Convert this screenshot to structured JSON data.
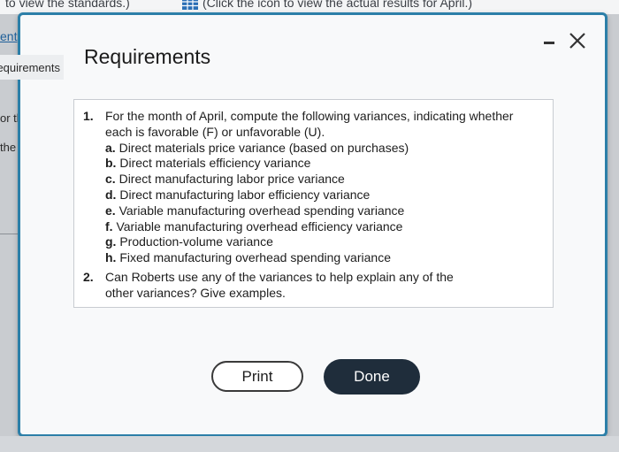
{
  "background": {
    "top_left_text": "to view the standards.)",
    "top_right_text": "(Click the icon to view the actual results for April.)",
    "left_fragments": [
      "or tl",
      "the"
    ],
    "grid_icon": "spreadsheet-grid-icon"
  },
  "dialog": {
    "tab_link": "ent",
    "tab_active": "equirements",
    "title": "Requirements",
    "minimize_icon": "minimize-icon",
    "close_icon": "close-icon",
    "requirements": [
      {
        "number": "1.",
        "lines": [
          "For the month of April, compute the following variances, indicating whether",
          "each is favorable (F) or unfavorable (U)."
        ],
        "subitems": [
          {
            "letter": "a.",
            "text": "Direct materials price variance (based on purchases)"
          },
          {
            "letter": "b.",
            "text": "Direct materials efficiency variance"
          },
          {
            "letter": "c.",
            "text": "Direct manufacturing labor price variance"
          },
          {
            "letter": "d.",
            "text": "Direct manufacturing labor efficiency variance"
          },
          {
            "letter": "e.",
            "text": "Variable manufacturing overhead spending variance"
          },
          {
            "letter": "f.",
            "text": "Variable manufacturing overhead efficiency variance"
          },
          {
            "letter": "g.",
            "text": "Production-volume variance"
          },
          {
            "letter": "h.",
            "text": "Fixed manufacturing overhead spending variance"
          }
        ]
      },
      {
        "number": "2.",
        "lines": [
          "Can Roberts use any of the variances to help explain any of the",
          "other variances? Give examples."
        ]
      }
    ],
    "print_label": "Print",
    "done_label": "Done"
  },
  "colors": {
    "dialog_border": "#2c7fa8",
    "done_button": "#1f2d3b",
    "link": "#1f5f99"
  }
}
